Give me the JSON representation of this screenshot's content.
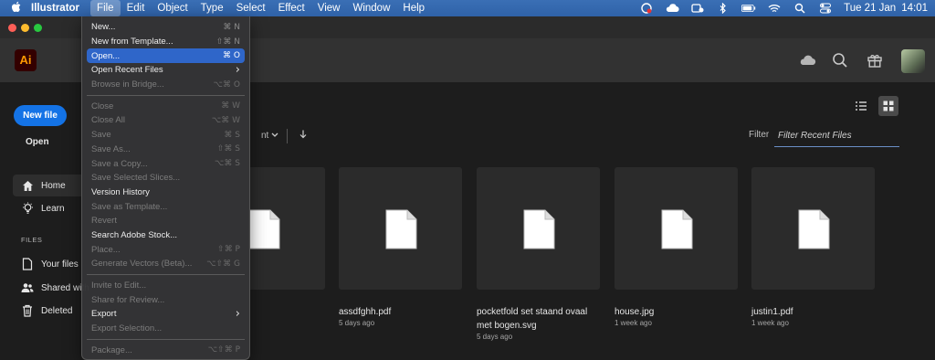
{
  "menubar": {
    "app_name": "Illustrator",
    "items": [
      "File",
      "Edit",
      "Object",
      "Type",
      "Select",
      "Effect",
      "View",
      "Window",
      "Help"
    ],
    "clock_date": "Tue 21 Jan",
    "clock_time": "14:01"
  },
  "file_menu": {
    "rows": [
      {
        "label": "New...",
        "shortcut": "⌘ N",
        "state": "normal"
      },
      {
        "label": "New from Template...",
        "shortcut": "⇧⌘ N",
        "state": "normal"
      },
      {
        "label": "Open...",
        "shortcut": "⌘ O",
        "state": "highlighted"
      },
      {
        "label": "Open Recent Files",
        "shortcut": "›",
        "state": "normal"
      },
      {
        "label": "Browse in Bridge...",
        "shortcut": "⌥⌘ O",
        "state": "disabled"
      },
      {
        "sep": true
      },
      {
        "label": "Close",
        "shortcut": "⌘ W",
        "state": "disabled"
      },
      {
        "label": "Close All",
        "shortcut": "⌥⌘ W",
        "state": "disabled"
      },
      {
        "label": "Save",
        "shortcut": "⌘ S",
        "state": "disabled"
      },
      {
        "label": "Save As...",
        "shortcut": "⇧⌘ S",
        "state": "disabled"
      },
      {
        "label": "Save a Copy...",
        "shortcut": "⌥⌘ S",
        "state": "disabled"
      },
      {
        "label": "Save Selected Slices...",
        "shortcut": "",
        "state": "disabled"
      },
      {
        "label": "Version History",
        "shortcut": "",
        "state": "normal"
      },
      {
        "label": "Save as Template...",
        "shortcut": "",
        "state": "disabled"
      },
      {
        "label": "Revert",
        "shortcut": "",
        "state": "disabled"
      },
      {
        "label": "Search Adobe Stock...",
        "shortcut": "",
        "state": "normal"
      },
      {
        "label": "Place...",
        "shortcut": "⇧⌘ P",
        "state": "disabled"
      },
      {
        "label": "Generate Vectors (Beta)...",
        "shortcut": "⌥⇧⌘ G",
        "state": "disabled"
      },
      {
        "sep": true
      },
      {
        "label": "Invite to Edit...",
        "shortcut": "",
        "state": "disabled"
      },
      {
        "label": "Share for Review...",
        "shortcut": "",
        "state": "disabled"
      },
      {
        "label": "Export",
        "shortcut": "›",
        "state": "normal"
      },
      {
        "label": "Export Selection...",
        "shortcut": "",
        "state": "disabled"
      },
      {
        "sep": true
      },
      {
        "label": "Package...",
        "shortcut": "⌥⇧⌘ P",
        "state": "disabled"
      }
    ]
  },
  "header": {
    "logo_text": "Ai"
  },
  "sidebar": {
    "new_file_label": "New file",
    "open_label": "Open",
    "files_heading": "FILES",
    "nav": [
      {
        "label": "Home",
        "icon": "home-icon",
        "selected": true
      },
      {
        "label": "Learn",
        "icon": "lightbulb-icon",
        "selected": false
      }
    ],
    "files": [
      {
        "label": "Your files",
        "icon": "file-icon"
      },
      {
        "label": "Shared with",
        "icon": "people-icon"
      },
      {
        "label": "Deleted",
        "icon": "trash-icon"
      }
    ]
  },
  "main": {
    "sort_fragment": "nt",
    "filter_label": "Filter",
    "filter_placeholder": "Filter Recent Files",
    "files": [
      {
        "name": "",
        "meta": ""
      },
      {
        "name": "assdfghh.pdf",
        "meta": "5 days ago"
      },
      {
        "name": "pocketfold set staand ovaal met bogen.svg",
        "meta": "5 days ago"
      },
      {
        "name": "house.jpg",
        "meta": "1 week ago"
      },
      {
        "name": "justin1.pdf",
        "meta": "1 week ago"
      }
    ]
  },
  "colors": {
    "accent": "#1473e6",
    "menu_highlight": "#2f66c9",
    "menubar": "#3a6fb5",
    "ai_logo_fg": "#ff9a00",
    "ai_logo_bg": "#330000"
  }
}
